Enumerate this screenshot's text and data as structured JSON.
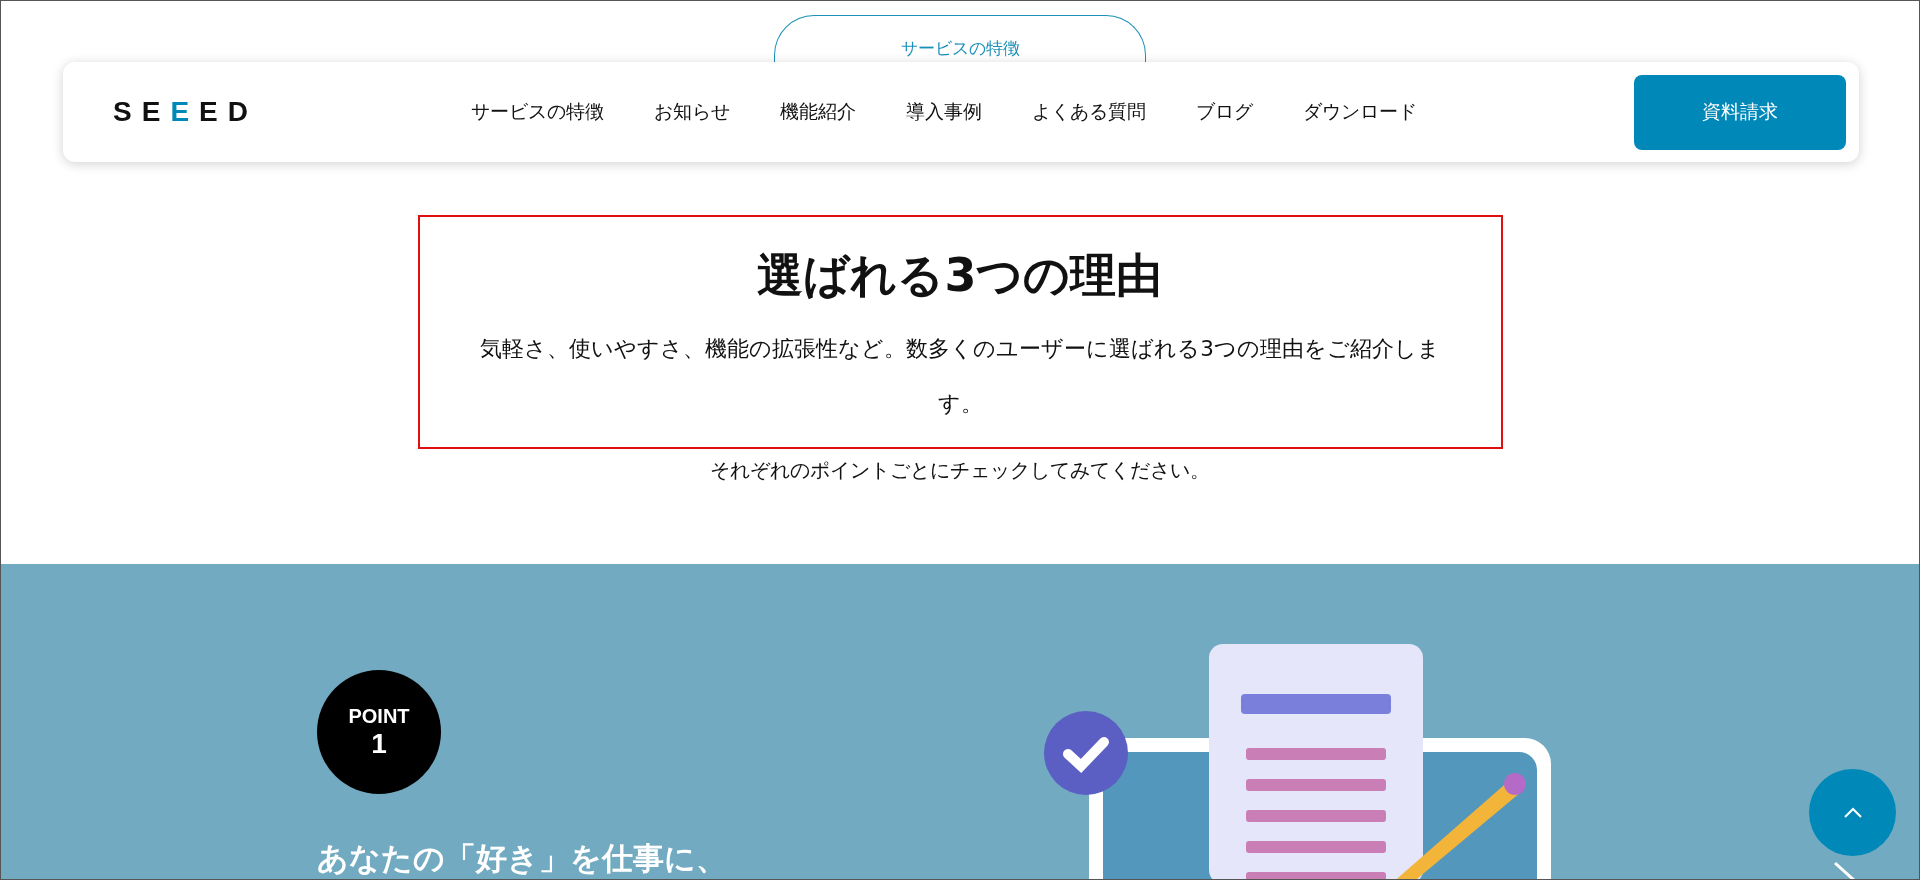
{
  "top_tab": {
    "label": "サービスの特徴"
  },
  "header": {
    "logo": [
      {
        "letter": "S",
        "accent": false
      },
      {
        "letter": "E",
        "accent": false
      },
      {
        "letter": "E",
        "accent": true
      },
      {
        "letter": "E",
        "accent": false
      },
      {
        "letter": "D",
        "accent": false
      }
    ],
    "nav": [
      "サービスの特徴",
      "お知らせ",
      "機能紹介",
      "導入事例",
      "よくある質問",
      "ブログ",
      "ダウンロード"
    ],
    "cta": "資料請求"
  },
  "intro": {
    "title": "選ばれる3つの理由",
    "lead": "気軽さ、使いやすさ、機能の拡張性など。数多くのユーザーに選ばれる3つの理由をご紹介します。",
    "sub": "それぞれのポイントごとにチェックしてみてください。"
  },
  "point": {
    "badge_label": "POINT",
    "badge_number": "1",
    "heading": "あなたの「好き」を仕事に、"
  }
}
